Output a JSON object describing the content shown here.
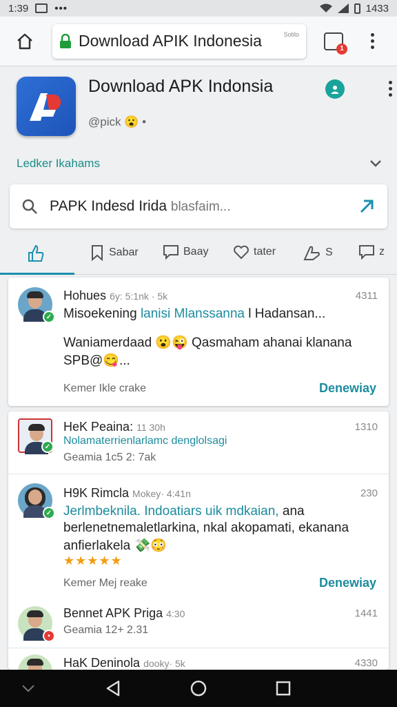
{
  "status": {
    "time": "1:39",
    "right_time": "1433"
  },
  "browser": {
    "url_title": "Download APIK Indonesia",
    "url_suffix": "...",
    "url_sub": "Sotilo",
    "tab_badge": "1"
  },
  "app": {
    "title": "Download APK Indonsia",
    "handle": "@pick",
    "section_label": "Ledker Ikahams"
  },
  "search": {
    "query": "PAPK Indesd Irida",
    "placeholder": "blasfaim..."
  },
  "actions": [
    {
      "label": ""
    },
    {
      "label": "Sabar"
    },
    {
      "label": "Baay"
    },
    {
      "label": "tater"
    },
    {
      "label": "S"
    },
    {
      "label": "z"
    }
  ],
  "posts": [
    {
      "name": "Hohues",
      "meta": "6y: 5:1nk  · 5k",
      "time": "4311",
      "line1_plain": "Misoekening ",
      "line1_hl": "lanisi Mlanssanna",
      "line1_tail": " l Hadansan...",
      "line2": "Waniamerdaad 😮😜 Qasmaham ahanai klanana",
      "line3": "SPB@😋...",
      "foot_left": "Kemer  Ikle crake",
      "foot_right": "Denewiay"
    },
    {
      "name": "HeK Peaina:",
      "meta": "11 30h",
      "time": "1310",
      "sub1": "Nolamaterrienlarlamc denglolsagi",
      "sub2": "Geamia  1c5 2: 7ak"
    },
    {
      "name": "H9K Rimcla",
      "meta": "Mokey· 4:41n",
      "time": "230",
      "line1_hl": "Jerlmbeknila. Indoatiars uik mdkaian,",
      "line1_tail": " ana",
      "line2": "berlenetnemaletlarkina, nkal akopamati, ekanana",
      "line3": "anfierlakela 💸😳",
      "stars": "★★★★★",
      "foot_left": "Kemer  Mej reake",
      "foot_right": "Denewiay"
    },
    {
      "name": "Bennet APK Priga",
      "meta": "4:30",
      "time": "1441",
      "sub": "Geamia  12+ 2.31"
    },
    {
      "name": "HaK Deninola",
      "meta": "dooky· 5k",
      "time": "4330"
    }
  ],
  "colors": {
    "accent": "#1b8c9e",
    "brand_blue": "#1e54b8",
    "brand_red": "#e53935",
    "star": "#f39c12"
  }
}
